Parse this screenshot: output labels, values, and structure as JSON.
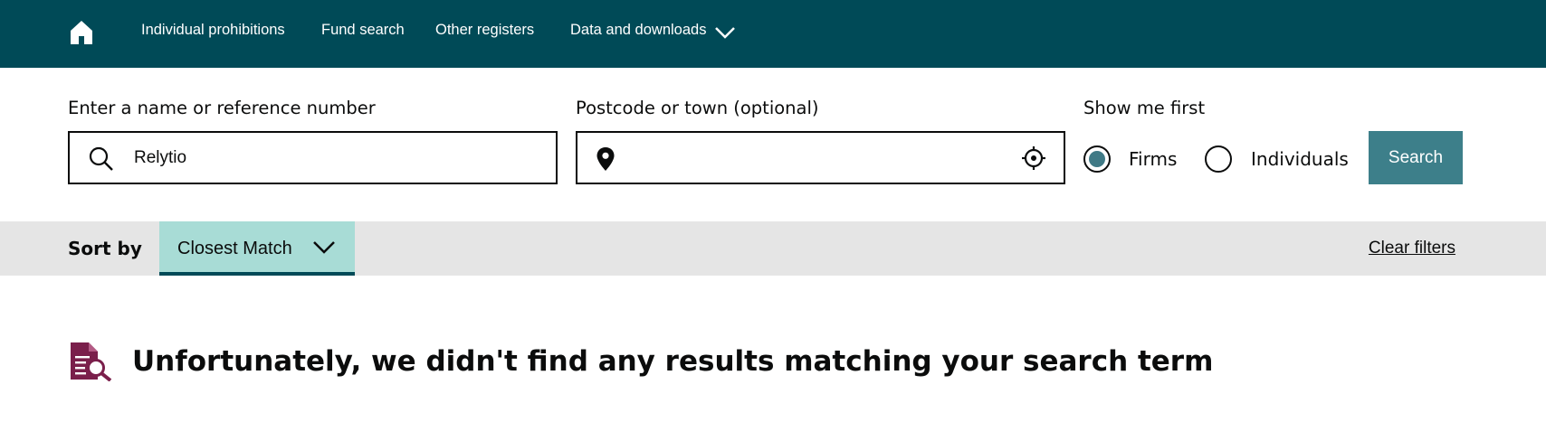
{
  "nav": {
    "home_icon": "home-icon",
    "links": [
      {
        "label": "Individual prohibitions"
      },
      {
        "label": "Fund search"
      },
      {
        "label": "Other registers"
      },
      {
        "label": "Data and downloads",
        "icon": "chevron-down-icon"
      }
    ]
  },
  "search": {
    "name_label": "Enter a name or reference number",
    "name_value": "Relytio",
    "name_icon": "search-icon",
    "postcode_label": "Postcode or town (optional)",
    "postcode_value": "",
    "postcode_icon": "location-pin-icon",
    "locate_icon": "crosshair-icon",
    "show_first_label": "Show me first",
    "options": [
      {
        "label": "Firms",
        "checked": true
      },
      {
        "label": "Individuals",
        "checked": false
      }
    ],
    "button_label": "Search"
  },
  "sort": {
    "label": "Sort by",
    "selected": "Closest Match",
    "clear_filters": "Clear filters"
  },
  "results": {
    "message": "Unfortunately, we didn't find any results matching your search term",
    "icon": "document-search-icon"
  },
  "colors": {
    "nav_bg": "#004a57",
    "accent": "#3d7f8a",
    "sort_selected_bg": "#a8dcd6",
    "icon_maroon": "#7a1f4b"
  }
}
